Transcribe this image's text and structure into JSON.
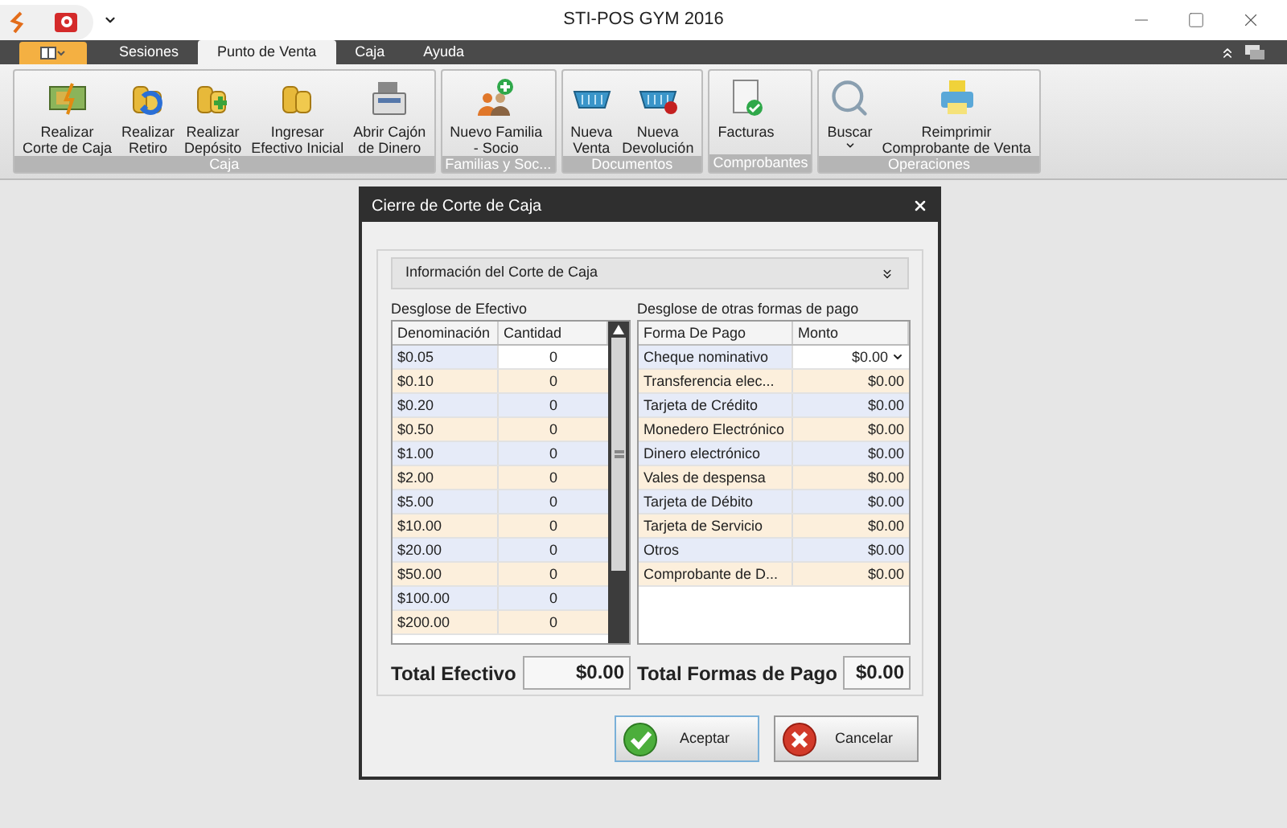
{
  "window": {
    "title": "STI-POS GYM 2016"
  },
  "tabs": [
    {
      "label": "Sesiones",
      "selected": false
    },
    {
      "label": "Punto de Venta",
      "selected": true
    },
    {
      "label": "Caja",
      "selected": false
    },
    {
      "label": "Ayuda",
      "selected": false
    }
  ],
  "ribbon_groups": [
    {
      "label": "Caja",
      "buttons": [
        {
          "lines": [
            "Realizar",
            "Corte de Caja"
          ],
          "has_menu": false
        },
        {
          "lines": [
            "Realizar",
            "Retiro"
          ],
          "has_menu": false
        },
        {
          "lines": [
            "Realizar",
            "Depósito"
          ],
          "has_menu": false
        },
        {
          "lines": [
            "Ingresar",
            "Efectivo Inicial"
          ],
          "has_menu": false
        },
        {
          "lines": [
            "Abrir Cajón",
            "de Dinero"
          ],
          "has_menu": false
        }
      ]
    },
    {
      "label": "Familias y Soc...",
      "buttons": [
        {
          "lines": [
            "Nuevo Familia",
            "- Socio"
          ],
          "has_menu": false
        }
      ]
    },
    {
      "label": "Documentos",
      "buttons": [
        {
          "lines": [
            "Nueva",
            "Venta"
          ],
          "has_menu": false
        },
        {
          "lines": [
            "Nueva",
            "Devolución"
          ],
          "has_menu": false
        }
      ]
    },
    {
      "label": "Comprobantes",
      "buttons": [
        {
          "lines": [
            "Facturas"
          ],
          "has_menu": false
        }
      ]
    },
    {
      "label": "Operaciones",
      "buttons": [
        {
          "lines": [
            "Buscar"
          ],
          "has_menu": true
        },
        {
          "lines": [
            "Reimprimir",
            "Comprobante de Venta"
          ],
          "has_menu": false
        }
      ]
    }
  ],
  "dialog": {
    "title": "Cierre de Corte de Caja",
    "info_panel": {
      "label": "Información del Corte de Caja",
      "expanded": false
    },
    "cash": {
      "label": "Desglose de Efectivo",
      "columns": [
        "Denominación",
        "Cantidad"
      ],
      "rows": [
        {
          "cells": [
            "$0.05",
            "0"
          ],
          "editing": true
        },
        {
          "cells": [
            "$0.10",
            "0"
          ],
          "editing": false
        },
        {
          "cells": [
            "$0.20",
            "0"
          ],
          "editing": false
        },
        {
          "cells": [
            "$0.50",
            "0"
          ],
          "editing": false
        },
        {
          "cells": [
            "$1.00",
            "0"
          ],
          "editing": false
        },
        {
          "cells": [
            "$2.00",
            "0"
          ],
          "editing": false
        },
        {
          "cells": [
            "$5.00",
            "0"
          ],
          "editing": false
        },
        {
          "cells": [
            "$10.00",
            "0"
          ],
          "editing": false
        },
        {
          "cells": [
            "$20.00",
            "0"
          ],
          "editing": false
        },
        {
          "cells": [
            "$50.00",
            "0"
          ],
          "editing": false
        },
        {
          "cells": [
            "$100.00",
            "0"
          ],
          "editing": false
        },
        {
          "cells": [
            "$200.00",
            "0"
          ],
          "editing": false
        }
      ],
      "total_label": "Total Efectivo",
      "total": "$0.00"
    },
    "other": {
      "label": "Desglose de otras formas de pago",
      "columns": [
        "Forma De Pago",
        "Monto"
      ],
      "rows": [
        {
          "cells": [
            "Cheque nominativo",
            "$0.00"
          ],
          "editing": true
        },
        {
          "cells": [
            "Transferencia elec...",
            "$0.00"
          ],
          "editing": false
        },
        {
          "cells": [
            "Tarjeta de Crédito",
            "$0.00"
          ],
          "editing": false
        },
        {
          "cells": [
            "Monedero Electrónico",
            "$0.00"
          ],
          "editing": false
        },
        {
          "cells": [
            "Dinero electrónico",
            "$0.00"
          ],
          "editing": false
        },
        {
          "cells": [
            "Vales de despensa",
            "$0.00"
          ],
          "editing": false
        },
        {
          "cells": [
            "Tarjeta de Débito",
            "$0.00"
          ],
          "editing": false
        },
        {
          "cells": [
            "Tarjeta de Servicio",
            "$0.00"
          ],
          "editing": false
        },
        {
          "cells": [
            "Otros",
            "$0.00"
          ],
          "editing": false
        },
        {
          "cells": [
            "Comprobante de D...",
            "$0.00"
          ],
          "editing": false
        }
      ],
      "total_label": "Total Formas de Pago",
      "total": "$0.00"
    },
    "buttons": [
      {
        "label": "Aceptar",
        "kind": "ok"
      },
      {
        "label": "Cancelar",
        "kind": "cancel"
      }
    ]
  }
}
